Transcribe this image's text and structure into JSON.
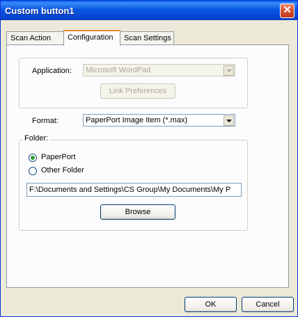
{
  "window": {
    "title": "Custom button1",
    "close_glyph": "✕"
  },
  "tabs": [
    {
      "label": "Scan Action"
    },
    {
      "label": "Configuration"
    },
    {
      "label": "Scan Settings"
    }
  ],
  "application": {
    "label": "Application:",
    "value": "Microsoft WordPad",
    "link_button": "Link Preferences"
  },
  "format": {
    "label": "Format:",
    "value": "PaperPort Image Item (*.max)"
  },
  "folder": {
    "label": "Folder:",
    "option_paperport": "PaperPort",
    "option_other": "Other Folder",
    "selected": "PaperPort",
    "path": "F:\\Documents and Settings\\CS Group\\My Documents\\My P",
    "browse_button": "Browse"
  },
  "footer": {
    "ok": "OK",
    "cancel": "Cancel"
  }
}
